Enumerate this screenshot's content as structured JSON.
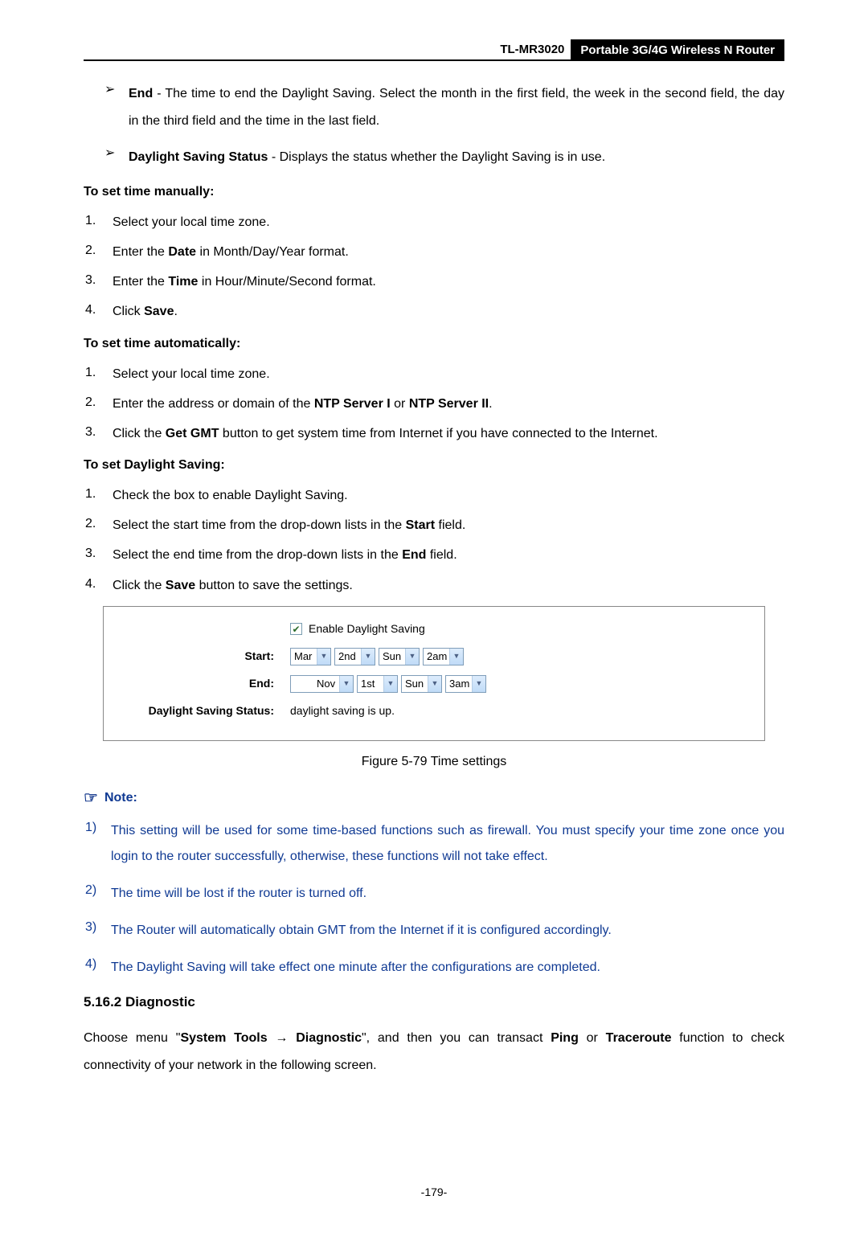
{
  "header": {
    "model": "TL-MR3020",
    "title": "Portable 3G/4G Wireless N Router"
  },
  "bullets": {
    "end": {
      "label": "End",
      "sep": " - ",
      "text": "The time to end the Daylight Saving. Select the month in the first field, the week in the second field, the day in the third field and the time in the last field."
    },
    "dss": {
      "label": "Daylight Saving Status",
      "sep": " - ",
      "text": "Displays the status whether the Daylight Saving is in use."
    }
  },
  "manual": {
    "head": "To set time manually:",
    "items": [
      {
        "n": "1.",
        "pre": "Select your local time zone."
      },
      {
        "n": "2.",
        "pre": "Enter the ",
        "bold": "Date",
        "post": " in Month/Day/Year format."
      },
      {
        "n": "3.",
        "pre": "Enter the ",
        "bold": "Time",
        "post": " in Hour/Minute/Second format."
      },
      {
        "n": "4.",
        "pre": "Click ",
        "bold": "Save",
        "post": "."
      }
    ]
  },
  "auto": {
    "head": "To set time automatically:",
    "items": [
      {
        "n": "1.",
        "text": "Select your local time zone."
      },
      {
        "n": "2.",
        "pre": "Enter the address or domain of the ",
        "b1": "NTP Server I",
        "mid": " or ",
        "b2": "NTP Server II",
        "post": "."
      },
      {
        "n": "3.",
        "pre": "Click the ",
        "bold": "Get GMT",
        "post": " button to get system time from Internet if you have connected to the Internet."
      }
    ]
  },
  "dst": {
    "head": "To set Daylight Saving:",
    "items": [
      {
        "n": "1.",
        "text": "Check the box to enable Daylight Saving."
      },
      {
        "n": "2.",
        "pre": "Select the start time from the drop-down lists in the ",
        "bold": "Start",
        "post": " field."
      },
      {
        "n": "3.",
        "pre": "Select the end time from the drop-down lists in the ",
        "bold": "End",
        "post": " field."
      },
      {
        "n": "4.",
        "pre": "Click the ",
        "bold": "Save",
        "post": " button to save the settings."
      }
    ]
  },
  "figure": {
    "enable": "Enable Daylight Saving",
    "start_label": "Start:",
    "end_label": "End:",
    "status_label": "Daylight Saving Status:",
    "status_value": "daylight saving is up.",
    "start": {
      "month": "Mar",
      "week": "2nd",
      "day": "Sun",
      "time": "2am"
    },
    "end": {
      "month": "Nov",
      "week": "1st",
      "day": "Sun",
      "time": "3am"
    },
    "caption": "Figure 5-79    Time settings"
  },
  "note": {
    "head": "Note:",
    "items": [
      {
        "n": "1)",
        "text": "This setting will be used for some time-based functions such as firewall. You must specify your time zone once you login to the router successfully, otherwise, these functions will not take effect."
      },
      {
        "n": "2)",
        "text": "The time will be lost if the router is turned off."
      },
      {
        "n": "3)",
        "text": "The Router will automatically obtain GMT from the Internet if it is configured accordingly."
      },
      {
        "n": "4)",
        "text": "The Daylight Saving will take effect one minute after the configurations are completed."
      }
    ]
  },
  "diag": {
    "heading": "5.16.2  Diagnostic",
    "pre": "Choose menu \"",
    "b1": "System Tools",
    "arrow": "  →  ",
    "b2": "Diagnostic",
    "mid": "\", and then you can transact ",
    "b3": "Ping",
    "or": " or ",
    "b4": "Traceroute",
    "post": " function to check connectivity of your network in the following screen."
  },
  "page": "-179-"
}
